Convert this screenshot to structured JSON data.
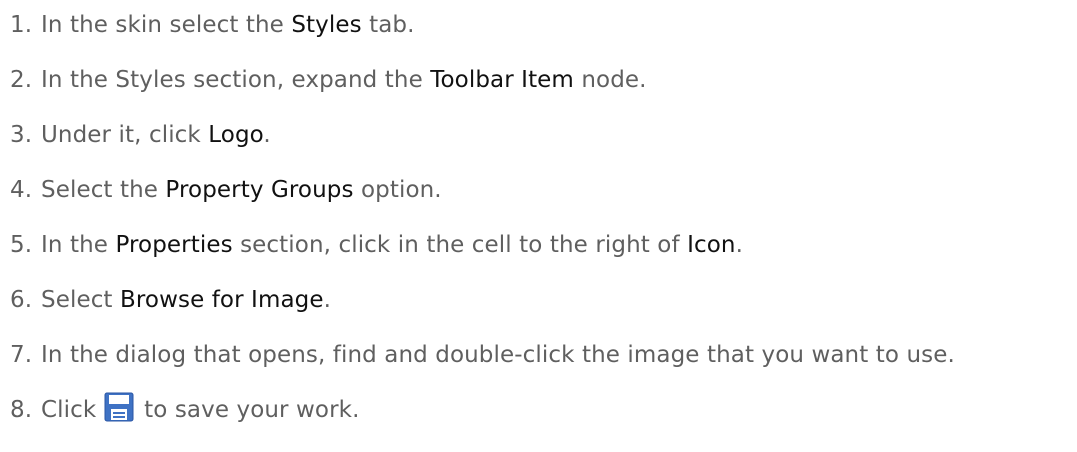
{
  "steps": [
    {
      "number": "1.",
      "parts": [
        "In the skin select the ",
        "Styles",
        " tab."
      ]
    },
    {
      "number": "2.",
      "parts": [
        "In the Styles section, expand the ",
        "Toolbar Item",
        " node."
      ]
    },
    {
      "number": "3.",
      "parts": [
        "Under it, click ",
        "Logo",
        "."
      ]
    },
    {
      "number": "4.",
      "parts": [
        "Select the ",
        "Property Groups",
        " option."
      ]
    },
    {
      "number": "5.",
      "parts": [
        "In the ",
        "Properties",
        " section, click in the cell to the right of ",
        "Icon",
        "."
      ]
    },
    {
      "number": "6.",
      "parts": [
        "Select ",
        "Browse for Image",
        "."
      ]
    },
    {
      "number": "7.",
      "text": "In the dialog that opens, find and double-click the image that you want to use."
    },
    {
      "number": "8.",
      "before": "Click ",
      "icon": "save-icon",
      "after": " to save your work."
    }
  ],
  "colors": {
    "body_text": "#5f5f5f",
    "ui_term_text": "#111111",
    "save_icon_border": "#3f72c4",
    "save_icon_fill": "#ffffff"
  }
}
